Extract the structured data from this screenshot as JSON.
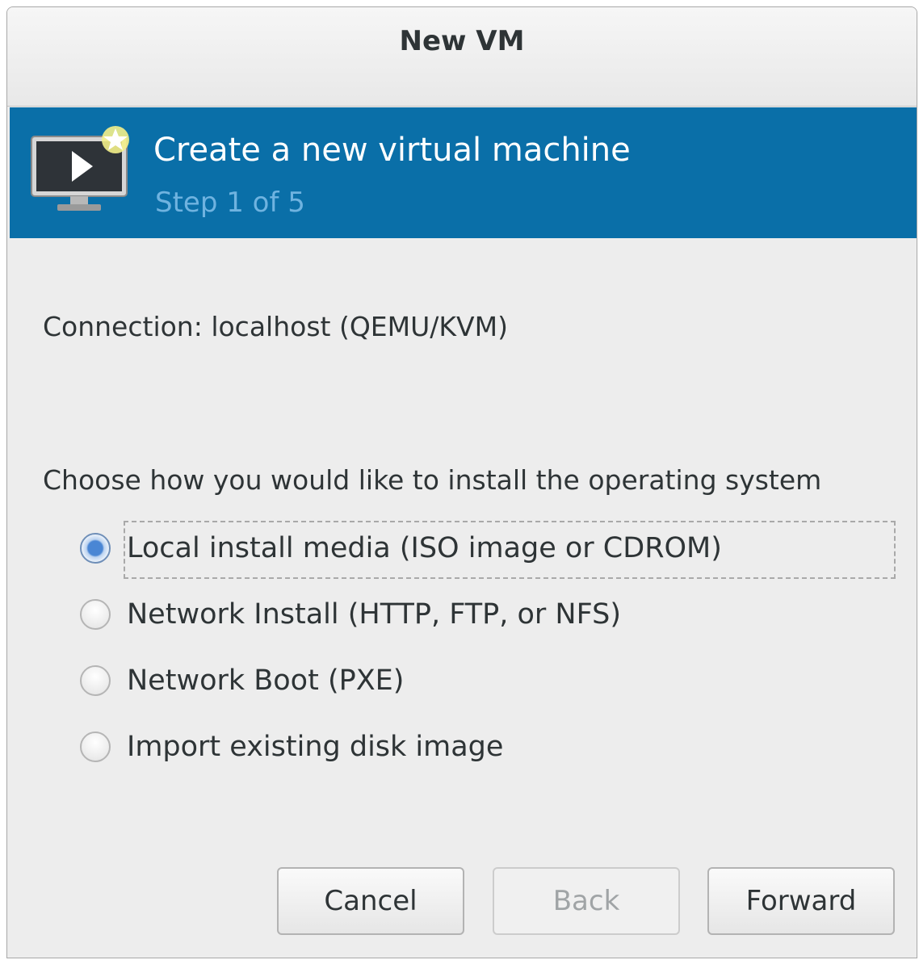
{
  "window": {
    "title": "New VM"
  },
  "banner": {
    "icon": "vm-monitor-new-icon",
    "heading": "Create a new virtual machine",
    "step": "Step 1 of 5"
  },
  "connection": {
    "text": "Connection:  localhost (QEMU/KVM)"
  },
  "install": {
    "prompt": "Choose how you would like to install the operating system",
    "options": [
      {
        "label": "Local install media (ISO image or CDROM)",
        "selected": true
      },
      {
        "label": "Network Install (HTTP, FTP, or NFS)",
        "selected": false
      },
      {
        "label": "Network Boot (PXE)",
        "selected": false
      },
      {
        "label": "Import existing disk image",
        "selected": false
      }
    ]
  },
  "buttons": {
    "cancel": "Cancel",
    "back": "Back",
    "forward": "Forward"
  }
}
